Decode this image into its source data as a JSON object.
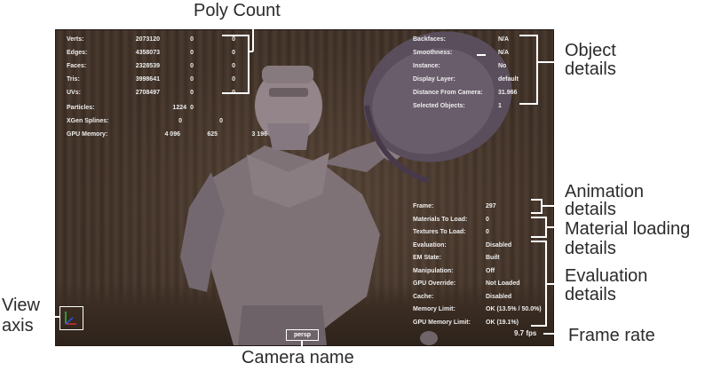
{
  "poly_count": {
    "rows": [
      {
        "label": "Verts:",
        "v1": "2073120",
        "v2": "0",
        "v3": "0"
      },
      {
        "label": "Edges:",
        "v1": "4358073",
        "v2": "0",
        "v3": "0"
      },
      {
        "label": "Faces:",
        "v1": "2328539",
        "v2": "0",
        "v3": "0"
      },
      {
        "label": "Tris:",
        "v1": "3998641",
        "v2": "0",
        "v3": "0"
      },
      {
        "label": "UVs:",
        "v1": "2708497",
        "v2": "0",
        "v3": "0"
      }
    ],
    "particles": {
      "label": "Particles:",
      "v1": "1224",
      "v2": "0"
    },
    "xgen": {
      "label": "XGen Splines:",
      "v1": "0",
      "v2": "0"
    },
    "gpu_memory": {
      "label": "GPU Memory:",
      "v1": "4 096",
      "v2": "625",
      "v3": "3 196"
    }
  },
  "object_details": [
    {
      "label": "Backfaces:",
      "value": "N/A"
    },
    {
      "label": "Smoothness:",
      "value": "N/A"
    },
    {
      "label": "Instance:",
      "value": "No"
    },
    {
      "label": "Display Layer:",
      "value": "default"
    },
    {
      "label": "Distance From Camera:",
      "value": "31.966"
    },
    {
      "label": "Selected Objects:",
      "value": "1"
    }
  ],
  "lower_details": [
    {
      "label": "Frame:",
      "value": "297"
    },
    {
      "label": "Materials To Load:",
      "value": "0"
    },
    {
      "label": "Textures To Load:",
      "value": "0"
    },
    {
      "label": "Evaluation:",
      "value": "Disabled"
    },
    {
      "label": "EM State:",
      "value": "Built"
    },
    {
      "label": "Manipulation:",
      "value": "Off"
    },
    {
      "label": "GPU Override:",
      "value": "Not Loaded"
    },
    {
      "label": "Cache:",
      "value": "Disabled"
    },
    {
      "label": "Memory Limit:",
      "value": "OK (13.5% / 50.0%)"
    },
    {
      "label": "GPU Memory Limit:",
      "value": "OK (19.1%)"
    }
  ],
  "camera_name": "persp",
  "frame_rate": "9.7 fps",
  "callouts": {
    "poly_count": "Poly Count",
    "object_details_1": "Object",
    "object_details_2": "details",
    "animation_1": "Animation",
    "animation_2": "details",
    "material_1": "Material loading",
    "material_2": "details",
    "evaluation_1": "Evaluation",
    "evaluation_2": "details",
    "frame_rate": "Frame rate",
    "view_axis_1": "View",
    "view_axis_2": "axis",
    "camera_name": "Camera name"
  },
  "colors": {
    "background_dark": "#3d3027",
    "figure": "#8c7f84",
    "hud_text": "#eeeeee",
    "callout_lines": "#ffffff",
    "callout_text": "#2b2b2b",
    "axis_x": "#d03030",
    "axis_y": "#30c030",
    "axis_z": "#3050e0"
  }
}
